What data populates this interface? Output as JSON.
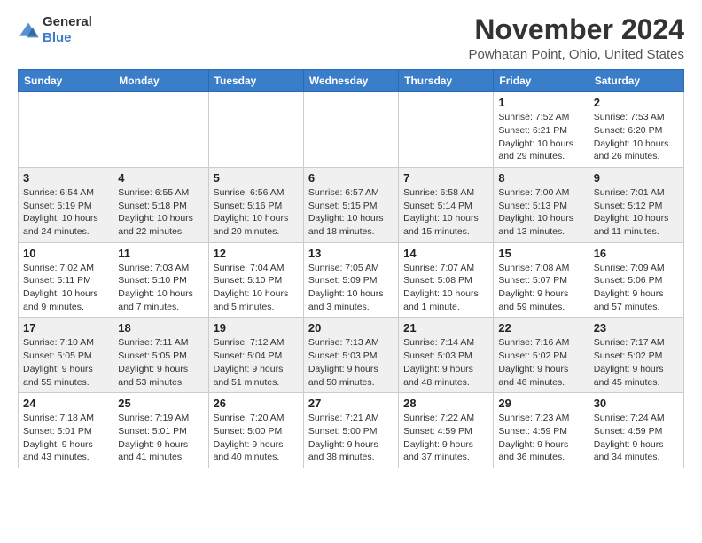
{
  "logo": {
    "general": "General",
    "blue": "Blue"
  },
  "header": {
    "month": "November 2024",
    "location": "Powhatan Point, Ohio, United States"
  },
  "weekdays": [
    "Sunday",
    "Monday",
    "Tuesday",
    "Wednesday",
    "Thursday",
    "Friday",
    "Saturday"
  ],
  "weeks": [
    [
      {
        "day": "",
        "info": ""
      },
      {
        "day": "",
        "info": ""
      },
      {
        "day": "",
        "info": ""
      },
      {
        "day": "",
        "info": ""
      },
      {
        "day": "",
        "info": ""
      },
      {
        "day": "1",
        "info": "Sunrise: 7:52 AM\nSunset: 6:21 PM\nDaylight: 10 hours and 29 minutes."
      },
      {
        "day": "2",
        "info": "Sunrise: 7:53 AM\nSunset: 6:20 PM\nDaylight: 10 hours and 26 minutes."
      }
    ],
    [
      {
        "day": "3",
        "info": "Sunrise: 6:54 AM\nSunset: 5:19 PM\nDaylight: 10 hours and 24 minutes."
      },
      {
        "day": "4",
        "info": "Sunrise: 6:55 AM\nSunset: 5:18 PM\nDaylight: 10 hours and 22 minutes."
      },
      {
        "day": "5",
        "info": "Sunrise: 6:56 AM\nSunset: 5:16 PM\nDaylight: 10 hours and 20 minutes."
      },
      {
        "day": "6",
        "info": "Sunrise: 6:57 AM\nSunset: 5:15 PM\nDaylight: 10 hours and 18 minutes."
      },
      {
        "day": "7",
        "info": "Sunrise: 6:58 AM\nSunset: 5:14 PM\nDaylight: 10 hours and 15 minutes."
      },
      {
        "day": "8",
        "info": "Sunrise: 7:00 AM\nSunset: 5:13 PM\nDaylight: 10 hours and 13 minutes."
      },
      {
        "day": "9",
        "info": "Sunrise: 7:01 AM\nSunset: 5:12 PM\nDaylight: 10 hours and 11 minutes."
      }
    ],
    [
      {
        "day": "10",
        "info": "Sunrise: 7:02 AM\nSunset: 5:11 PM\nDaylight: 10 hours and 9 minutes."
      },
      {
        "day": "11",
        "info": "Sunrise: 7:03 AM\nSunset: 5:10 PM\nDaylight: 10 hours and 7 minutes."
      },
      {
        "day": "12",
        "info": "Sunrise: 7:04 AM\nSunset: 5:10 PM\nDaylight: 10 hours and 5 minutes."
      },
      {
        "day": "13",
        "info": "Sunrise: 7:05 AM\nSunset: 5:09 PM\nDaylight: 10 hours and 3 minutes."
      },
      {
        "day": "14",
        "info": "Sunrise: 7:07 AM\nSunset: 5:08 PM\nDaylight: 10 hours and 1 minute."
      },
      {
        "day": "15",
        "info": "Sunrise: 7:08 AM\nSunset: 5:07 PM\nDaylight: 9 hours and 59 minutes."
      },
      {
        "day": "16",
        "info": "Sunrise: 7:09 AM\nSunset: 5:06 PM\nDaylight: 9 hours and 57 minutes."
      }
    ],
    [
      {
        "day": "17",
        "info": "Sunrise: 7:10 AM\nSunset: 5:05 PM\nDaylight: 9 hours and 55 minutes."
      },
      {
        "day": "18",
        "info": "Sunrise: 7:11 AM\nSunset: 5:05 PM\nDaylight: 9 hours and 53 minutes."
      },
      {
        "day": "19",
        "info": "Sunrise: 7:12 AM\nSunset: 5:04 PM\nDaylight: 9 hours and 51 minutes."
      },
      {
        "day": "20",
        "info": "Sunrise: 7:13 AM\nSunset: 5:03 PM\nDaylight: 9 hours and 50 minutes."
      },
      {
        "day": "21",
        "info": "Sunrise: 7:14 AM\nSunset: 5:03 PM\nDaylight: 9 hours and 48 minutes."
      },
      {
        "day": "22",
        "info": "Sunrise: 7:16 AM\nSunset: 5:02 PM\nDaylight: 9 hours and 46 minutes."
      },
      {
        "day": "23",
        "info": "Sunrise: 7:17 AM\nSunset: 5:02 PM\nDaylight: 9 hours and 45 minutes."
      }
    ],
    [
      {
        "day": "24",
        "info": "Sunrise: 7:18 AM\nSunset: 5:01 PM\nDaylight: 9 hours and 43 minutes."
      },
      {
        "day": "25",
        "info": "Sunrise: 7:19 AM\nSunset: 5:01 PM\nDaylight: 9 hours and 41 minutes."
      },
      {
        "day": "26",
        "info": "Sunrise: 7:20 AM\nSunset: 5:00 PM\nDaylight: 9 hours and 40 minutes."
      },
      {
        "day": "27",
        "info": "Sunrise: 7:21 AM\nSunset: 5:00 PM\nDaylight: 9 hours and 38 minutes."
      },
      {
        "day": "28",
        "info": "Sunrise: 7:22 AM\nSunset: 4:59 PM\nDaylight: 9 hours and 37 minutes."
      },
      {
        "day": "29",
        "info": "Sunrise: 7:23 AM\nSunset: 4:59 PM\nDaylight: 9 hours and 36 minutes."
      },
      {
        "day": "30",
        "info": "Sunrise: 7:24 AM\nSunset: 4:59 PM\nDaylight: 9 hours and 34 minutes."
      }
    ]
  ]
}
